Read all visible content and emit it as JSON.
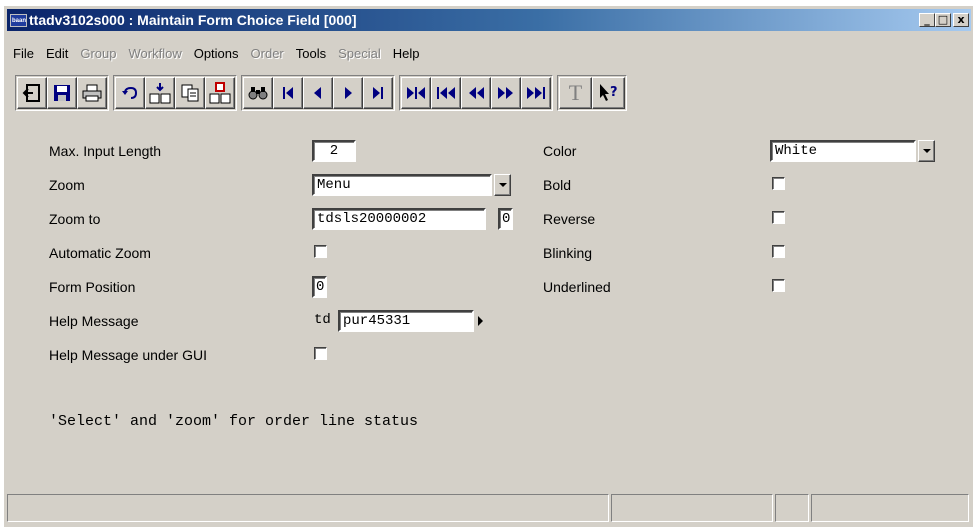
{
  "window": {
    "title": "ttadv3102s000 : Maintain Form Choice Field [000]",
    "app_icon_text": "baan",
    "buttons": {
      "minimize": "_",
      "maximize": "□",
      "close": "x"
    }
  },
  "menu": {
    "items": [
      {
        "label": "File",
        "enabled": true
      },
      {
        "label": "Edit",
        "enabled": true
      },
      {
        "label": "Group",
        "enabled": false
      },
      {
        "label": "Workflow",
        "enabled": false
      },
      {
        "label": "Options",
        "enabled": true
      },
      {
        "label": "Order",
        "enabled": false
      },
      {
        "label": "Tools",
        "enabled": true
      },
      {
        "label": "Special",
        "enabled": false
      },
      {
        "label": "Help",
        "enabled": true
      }
    ]
  },
  "toolbar": {
    "icons": [
      "exit-icon",
      "save-icon",
      "print-icon",
      "undo-icon",
      "insert-record-icon",
      "duplicate-icon",
      "delete-record-icon",
      "find-icon",
      "first-record-icon",
      "previous-record-icon",
      "next-record-icon",
      "last-record-icon",
      "first-set-icon",
      "previous-set-icon",
      "fast-back-icon",
      "fast-forward-icon",
      "last-set-icon",
      "text-icon",
      "context-help-icon"
    ]
  },
  "form": {
    "left": {
      "max_input_length": {
        "label": "Max. Input Length",
        "value": "2"
      },
      "zoom": {
        "label": "Zoom",
        "value": "Menu"
      },
      "zoom_to": {
        "label": "Zoom to",
        "value": "tdsls20000002",
        "extra": "0"
      },
      "automatic_zoom": {
        "label": "Automatic Zoom",
        "checked": false
      },
      "form_position": {
        "label": "Form Position",
        "value": "0"
      },
      "help_message": {
        "label": "Help Message",
        "prefix": "td",
        "value": "pur45331"
      },
      "help_message_gui": {
        "label": "Help Message under GUI",
        "checked": false
      }
    },
    "right": {
      "color": {
        "label": "Color",
        "value": "White"
      },
      "bold": {
        "label": "Bold",
        "checked": false
      },
      "reverse": {
        "label": "Reverse",
        "checked": false
      },
      "blinking": {
        "label": "Blinking",
        "checked": false
      },
      "underlined": {
        "label": "Underlined",
        "checked": false
      }
    },
    "note": "'Select' and 'zoom' for order line status"
  },
  "statusbar": {
    "panels": [
      "",
      "",
      "",
      ""
    ]
  }
}
